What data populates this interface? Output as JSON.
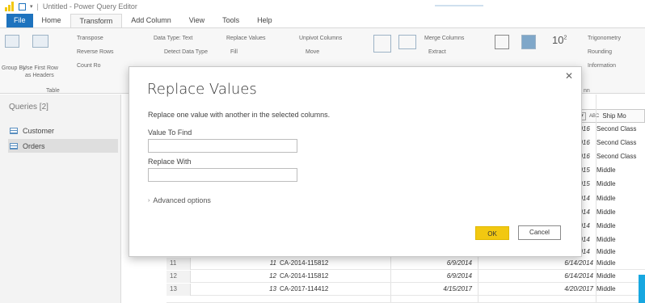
{
  "window": {
    "title": "Untitled - Power Query Editor",
    "separator": "|"
  },
  "menu": {
    "items": [
      "File",
      "Home",
      "Transform",
      "Add Column",
      "View",
      "Tools",
      "Help"
    ],
    "active_index": 2
  },
  "ribbon": {
    "group": "Group By",
    "group_by_line2": "By",
    "use_first_row": "Use First Row",
    "as_headers": "as Headers",
    "table_label": "Table",
    "transpose": "Transpose",
    "reverse_rows": "Reverse Rows",
    "count_rows": "Count Ro",
    "data_type": "Data Type: Text",
    "detect_data_type": "Detect Data Type",
    "replace_values": "Replace Values",
    "fill": "Fill",
    "unpivot_columns": "Unpivot Columns",
    "move": "Move",
    "merge_columns": "Merge Columns",
    "extract": "Extract",
    "trigonometry": "Trigonometry",
    "rounding": "Rounding",
    "information": "Information",
    "stat_10": "10",
    "stat_sup": "2",
    "fn_label": "nn"
  },
  "queries": {
    "title": "Queries [2]",
    "items": [
      {
        "name": "Customer",
        "selected": false
      },
      {
        "name": "Orders",
        "selected": true
      }
    ]
  },
  "grid": {
    "column_header": "Ship Mo",
    "column_type_icon": "ABC",
    "right_values": [
      {
        "date": "2016",
        "mode": "Second Class"
      },
      {
        "date": "2016",
        "mode": "Second Class"
      },
      {
        "date": "2016",
        "mode": "Second Class"
      },
      {
        "date": "2015",
        "mode": "Middle"
      },
      {
        "date": "2015",
        "mode": "Middle"
      },
      {
        "date": "2014",
        "mode": "Middle"
      },
      {
        "date": "2014",
        "mode": "Middle"
      },
      {
        "date": "2014",
        "mode": "Middle"
      },
      {
        "date": "2014",
        "mode": "Middle"
      },
      {
        "date": "2014",
        "mode": "Middle"
      }
    ],
    "rows": [
      {
        "idx": "11",
        "num": "11",
        "order_id": "CA-2014-115812",
        "order_date": "6/9/2014",
        "ship_date": "6/14/2014",
        "mode": "Middle"
      },
      {
        "idx": "12",
        "num": "12",
        "order_id": "CA-2014-115812",
        "order_date": "6/9/2014",
        "ship_date": "6/14/2014",
        "mode": "Middle"
      },
      {
        "idx": "13",
        "num": "13",
        "order_id": "CA-2017-114412",
        "order_date": "4/15/2017",
        "ship_date": "4/20/2017",
        "mode": "Middle"
      }
    ]
  },
  "dialog": {
    "title": "Replace Values",
    "description": "Replace one value with another in the selected columns.",
    "find_label": "Value To Find",
    "find_value": "",
    "replace_label": "Replace With",
    "replace_value": "",
    "advanced": "Advanced options",
    "ok": "OK",
    "cancel": "Cancel",
    "close_glyph": "✕"
  },
  "colors": {
    "file_tab": "#1e73be",
    "ok_button": "#f2c811",
    "accent": "#17a7e0"
  }
}
